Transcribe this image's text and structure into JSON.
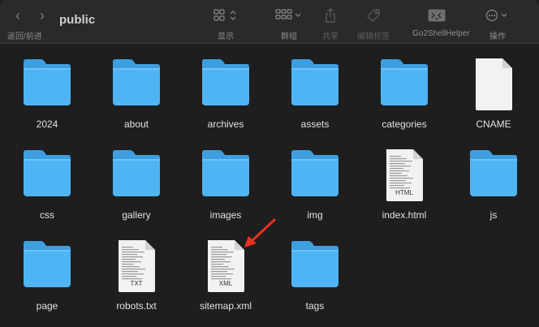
{
  "window": {
    "title": "public",
    "nav_label": "返回/前进",
    "back_glyph": "‹",
    "forward_glyph": "›"
  },
  "toolbar": {
    "view_label": "显示",
    "group_label": "群组",
    "share_label": "共享",
    "tags_label": "编辑标签",
    "go2shell_label": "Go2ShellHelper",
    "action_label": "操作"
  },
  "items": [
    {
      "name": "2024",
      "type": "folder"
    },
    {
      "name": "about",
      "type": "folder"
    },
    {
      "name": "archives",
      "type": "folder"
    },
    {
      "name": "assets",
      "type": "folder"
    },
    {
      "name": "categories",
      "type": "folder"
    },
    {
      "name": "CNAME",
      "type": "file"
    },
    {
      "name": "css",
      "type": "folder"
    },
    {
      "name": "gallery",
      "type": "folder"
    },
    {
      "name": "images",
      "type": "folder"
    },
    {
      "name": "img",
      "type": "folder"
    },
    {
      "name": "index.html",
      "type": "file",
      "badge": "HTML"
    },
    {
      "name": "js",
      "type": "folder"
    },
    {
      "name": "page",
      "type": "folder"
    },
    {
      "name": "robots.txt",
      "type": "file",
      "badge": "TXT"
    },
    {
      "name": "sitemap.xml",
      "type": "file",
      "badge": "XML"
    },
    {
      "name": "tags",
      "type": "folder"
    }
  ],
  "colors": {
    "folder_body": "#4fb4f4",
    "folder_tab": "#3d9fe0",
    "annotation_arrow": "#e8321f"
  }
}
